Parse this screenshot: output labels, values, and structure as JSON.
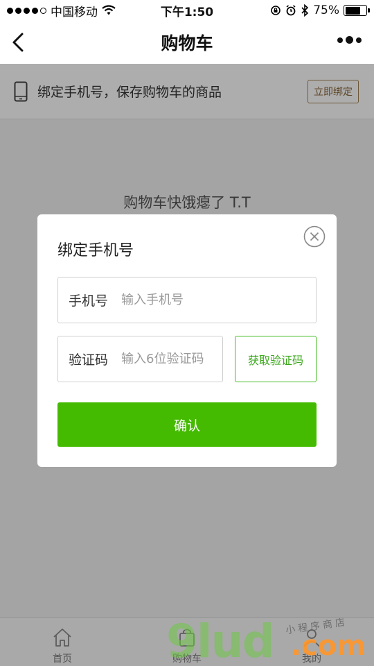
{
  "status_bar": {
    "carrier": "中国移动",
    "time": "下午1:50",
    "battery": "75%",
    "battery_level": 0.75
  },
  "nav": {
    "title": "购物车"
  },
  "banner": {
    "text": "绑定手机号，保存购物车的商品",
    "bind_button": "立即绑定"
  },
  "empty_state": {
    "text": "购物车快饿瘪了 T.T"
  },
  "dialog": {
    "title": "绑定手机号",
    "phone_label": "手机号",
    "phone_placeholder": "输入手机号",
    "code_label": "验证码",
    "code_placeholder": "输入6位验证码",
    "get_code_button": "获取验证码",
    "confirm_button": "确认"
  },
  "tabs": [
    {
      "label": "首页",
      "icon": "home-icon"
    },
    {
      "label": "购物车",
      "icon": "cart-icon"
    },
    {
      "label": "我的",
      "icon": "user-icon"
    }
  ],
  "watermark": {
    "main": "9lud",
    "sub": "小程序商店",
    "domain": ".com"
  },
  "colors": {
    "accent_green": "#44bb00",
    "bind_button_brown": "#8b6a3e",
    "mask": "rgba(0,0,0,0.32)"
  }
}
